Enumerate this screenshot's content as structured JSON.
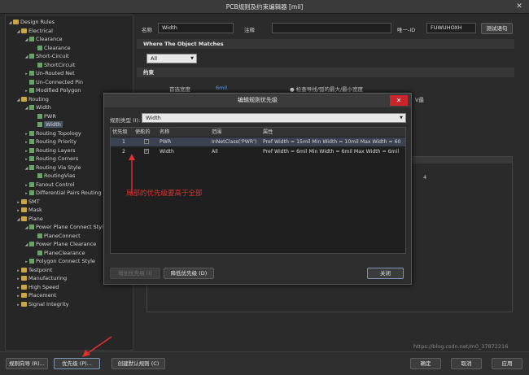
{
  "window": {
    "title": "PCB规则及约束编辑器 [mil]",
    "close_glyph": "✕"
  },
  "tree": {
    "items": [
      {
        "label": "Design Rules",
        "depth": 0,
        "icon": "folder-icon",
        "toggle": "◢"
      },
      {
        "label": "Electrical",
        "depth": 1,
        "icon": "folder-icon",
        "toggle": "◢"
      },
      {
        "label": "Clearance",
        "depth": 2,
        "icon": "rule-icon",
        "toggle": "◢"
      },
      {
        "label": "Clearance",
        "depth": 3,
        "icon": "rule-icon",
        "toggle": ""
      },
      {
        "label": "Short-Circuit",
        "depth": 2,
        "icon": "rule-icon",
        "toggle": "◢"
      },
      {
        "label": "ShortCircuit",
        "depth": 3,
        "icon": "rule-icon",
        "toggle": ""
      },
      {
        "label": "Un-Routed Net",
        "depth": 2,
        "icon": "rule-icon",
        "toggle": "▸"
      },
      {
        "label": "Un-Connected Pin",
        "depth": 2,
        "icon": "rule-icon",
        "toggle": ""
      },
      {
        "label": "Modified Polygon",
        "depth": 2,
        "icon": "rule-icon",
        "toggle": "▸"
      },
      {
        "label": "Routing",
        "depth": 1,
        "icon": "folder-icon",
        "toggle": "◢"
      },
      {
        "label": "Width",
        "depth": 2,
        "icon": "rule-icon",
        "toggle": "◢"
      },
      {
        "label": "PWR",
        "depth": 3,
        "icon": "rule-icon",
        "toggle": ""
      },
      {
        "label": "Width",
        "depth": 3,
        "icon": "rule-icon",
        "toggle": "",
        "selected": true
      },
      {
        "label": "Routing Topology",
        "depth": 2,
        "icon": "rule-icon",
        "toggle": "▸"
      },
      {
        "label": "Routing Priority",
        "depth": 2,
        "icon": "rule-icon",
        "toggle": "▸"
      },
      {
        "label": "Routing Layers",
        "depth": 2,
        "icon": "rule-icon",
        "toggle": "▸"
      },
      {
        "label": "Routing Corners",
        "depth": 2,
        "icon": "rule-icon",
        "toggle": "▸"
      },
      {
        "label": "Routing Via Style",
        "depth": 2,
        "icon": "rule-icon",
        "toggle": "◢"
      },
      {
        "label": "RoutingVias",
        "depth": 3,
        "icon": "rule-icon",
        "toggle": ""
      },
      {
        "label": "Fanout Control",
        "depth": 2,
        "icon": "rule-icon",
        "toggle": "▸"
      },
      {
        "label": "Differential Pairs Routing",
        "depth": 2,
        "icon": "rule-icon",
        "toggle": "▸"
      },
      {
        "label": "SMT",
        "depth": 1,
        "icon": "folder-icon",
        "toggle": "▸"
      },
      {
        "label": "Mask",
        "depth": 1,
        "icon": "folder-icon",
        "toggle": "▸"
      },
      {
        "label": "Plane",
        "depth": 1,
        "icon": "folder-icon",
        "toggle": "◢"
      },
      {
        "label": "Power Plane Connect Style",
        "depth": 2,
        "icon": "rule-icon",
        "toggle": "◢"
      },
      {
        "label": "PlaneConnect",
        "depth": 3,
        "icon": "rule-icon",
        "toggle": ""
      },
      {
        "label": "Power Plane Clearance",
        "depth": 2,
        "icon": "rule-icon",
        "toggle": "◢"
      },
      {
        "label": "PlaneClearance",
        "depth": 3,
        "icon": "rule-icon",
        "toggle": ""
      },
      {
        "label": "Polygon Connect Style",
        "depth": 2,
        "icon": "rule-icon",
        "toggle": "▸"
      },
      {
        "label": "Testpoint",
        "depth": 1,
        "icon": "folder-icon",
        "toggle": "▸"
      },
      {
        "label": "Manufacturing",
        "depth": 1,
        "icon": "folder-icon",
        "toggle": "▸"
      },
      {
        "label": "High Speed",
        "depth": 1,
        "icon": "folder-icon",
        "toggle": "▸"
      },
      {
        "label": "Placement",
        "depth": 1,
        "icon": "folder-icon",
        "toggle": "▸"
      },
      {
        "label": "Signal Integrity",
        "depth": 1,
        "icon": "folder-icon",
        "toggle": "▸"
      }
    ]
  },
  "rule": {
    "name_label": "名称",
    "name_value": "Width",
    "comment_label": "注释",
    "comment_value": "",
    "id_label": "唯一-ID",
    "id_value": "FUWUHOXH",
    "test_button": "测试语句",
    "where_header": "Where The Object Matches",
    "scope_select": "All",
    "constraints_header": "约束",
    "pref_width_label": "首选宽度",
    "pref_width_value": "6mil",
    "check_option": "检查导线/弧的最大/最小宽度",
    "right_trunc": "V最",
    "right_num": "4"
  },
  "bottom": {
    "wizard_button": "规则向导 (R)...",
    "priority_button": "优先级 (P)...",
    "default_button": "创建默认规则 (C)",
    "ok_button": "确定",
    "cancel_button": "取消",
    "apply_button": "应用",
    "watermark": "https://blog.csdn.net/m0_37872216"
  },
  "dialog": {
    "title": "编辑规则优先级",
    "close_glyph": "✕",
    "rule_type_label": "规则类型 (I):",
    "rule_type_value": "Width",
    "columns": [
      "优先级",
      "使能的",
      "名称",
      "范围",
      "属性"
    ],
    "rows": [
      {
        "priority": "1",
        "enabled": "✓",
        "name": "PWR",
        "scope": "InNetClass('PWR')",
        "attrs": "Pref Width = 15mil   Min Width = 10mil   Max Width = 60"
      },
      {
        "priority": "2",
        "enabled": "✓",
        "name": "Width",
        "scope": "All",
        "attrs": "Pref Width = 6mil   Min Width = 6mil   Max Width = 6mil"
      }
    ],
    "annotation": "局部的优先级要高于全部",
    "increase_button": "增加优先级 (I)",
    "decrease_button": "降低优先级 (D)",
    "close_button": "关闭"
  },
  "colors": {
    "accent_red": "#e0302e",
    "close_red": "#c8242a",
    "selection": "#3a4150"
  }
}
